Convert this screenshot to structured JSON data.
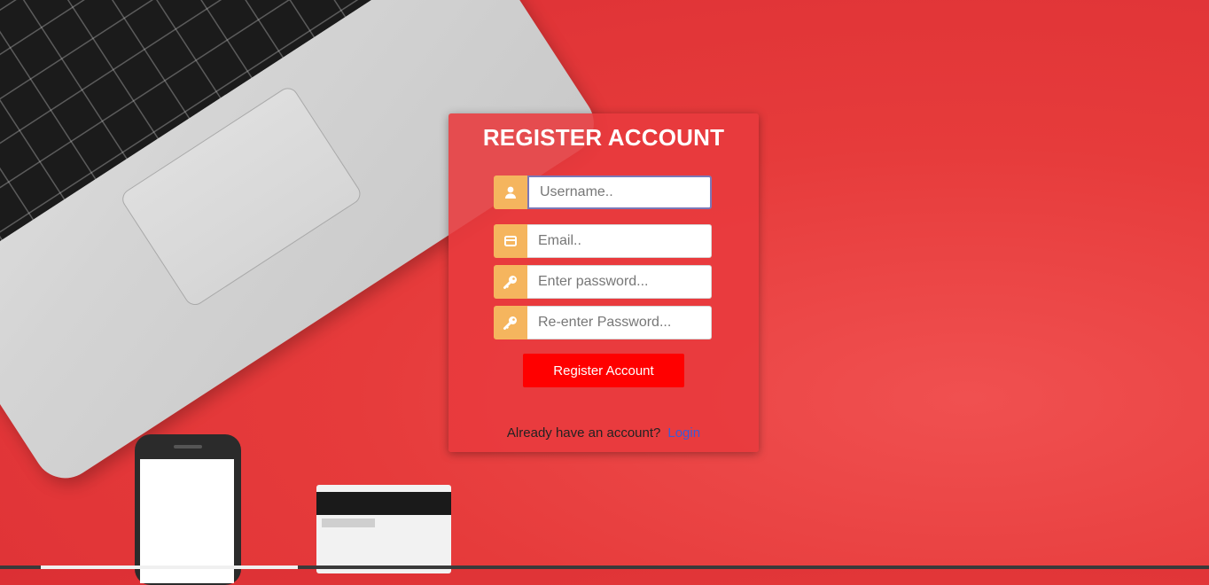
{
  "form": {
    "title": "REGISTER ACCOUNT",
    "fields": [
      {
        "icon": "user-icon",
        "placeholder": "Username..",
        "value": ""
      },
      {
        "icon": "envelope-icon",
        "placeholder": "Email..",
        "value": ""
      },
      {
        "icon": "key-icon",
        "placeholder": "Enter password...",
        "value": ""
      },
      {
        "icon": "key-icon",
        "placeholder": "Re-enter Password...",
        "value": ""
      }
    ],
    "submit_label": "Register Account",
    "footer_text": "Already have an account?",
    "login_link": "Login"
  },
  "colors": {
    "background": "#e63b3b",
    "panel": "#e83a3e",
    "addon": "#f5b55e",
    "button": "#ff0000",
    "link": "#3b5bd6"
  }
}
